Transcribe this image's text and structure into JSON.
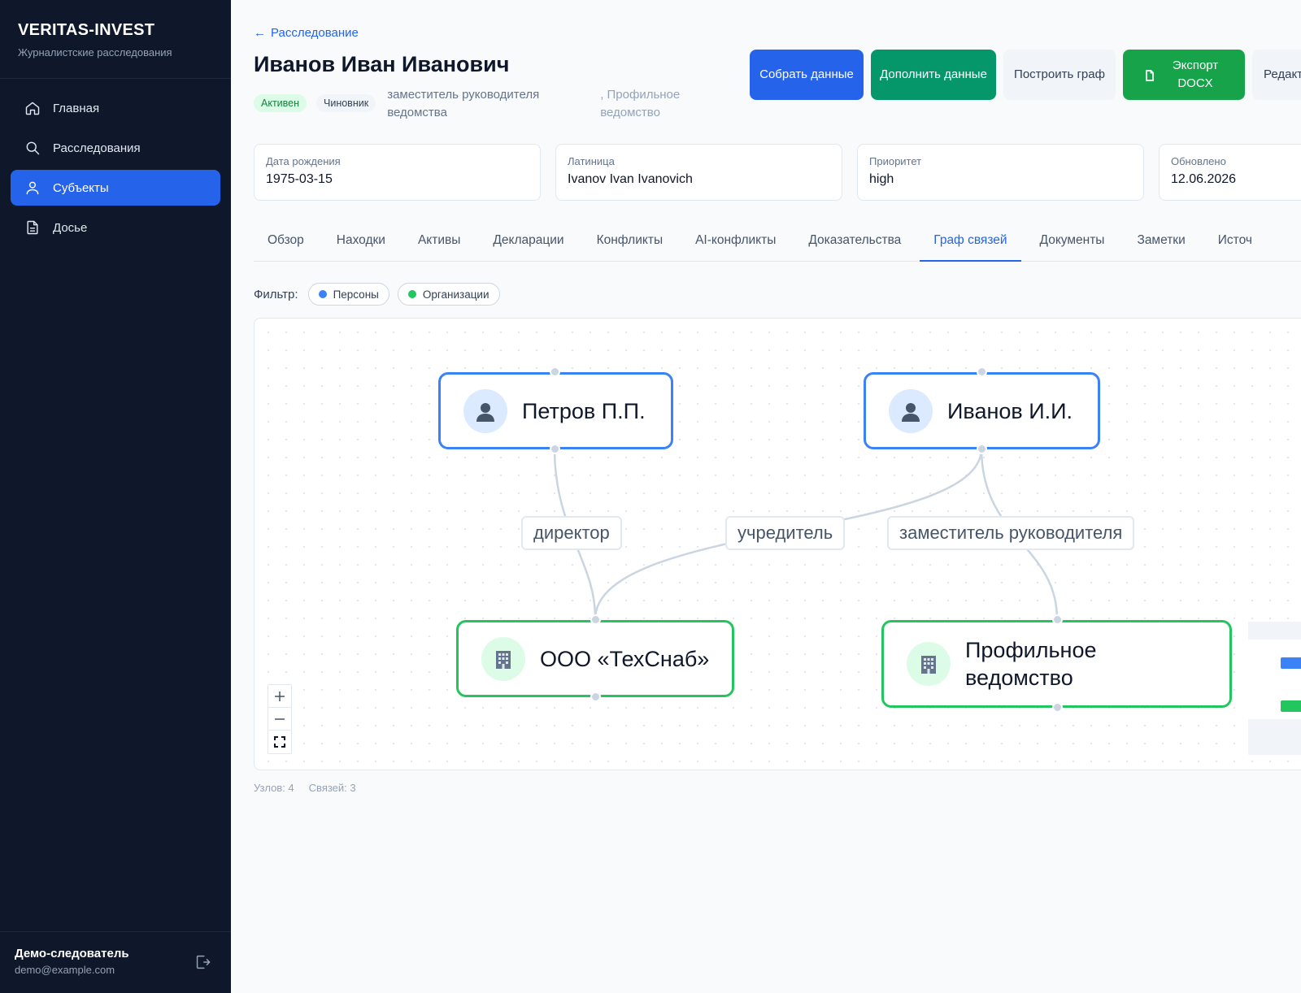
{
  "brand": {
    "title": "VERITAS-INVEST",
    "subtitle": "Журналистские расследования"
  },
  "nav": [
    {
      "label": "Главная",
      "icon": "home-icon"
    },
    {
      "label": "Расследования",
      "icon": "search-icon"
    },
    {
      "label": "Субъекты",
      "icon": "user-icon",
      "active": true
    },
    {
      "label": "Досье",
      "icon": "document-icon"
    }
  ],
  "user": {
    "name": "Демо-следователь",
    "email": "demo@example.com"
  },
  "header": {
    "back_label": "Расследование",
    "title": "Иванов Иван Иванович",
    "status_badge": "Активен",
    "role_badge": "Чиновник",
    "position": "заместитель руководителя ведомства",
    "organization": ", Профильное ведомство"
  },
  "actions": {
    "collect": "Собрать данные",
    "supplement": "Дополнить данные",
    "build_graph": "Построить граф",
    "export": "Экспорт DOCX",
    "edit": "Редакт"
  },
  "info": [
    {
      "label": "Дата рождения",
      "value": "1975-03-15"
    },
    {
      "label": "Латиница",
      "value": "Ivanov Ivan Ivanovich"
    },
    {
      "label": "Приоритет",
      "value": "high"
    },
    {
      "label": "Обновлено",
      "value": "12.06.2026"
    }
  ],
  "tabs": [
    "Обзор",
    "Находки",
    "Активы",
    "Декларации",
    "Конфликты",
    "AI-конфликты",
    "Доказательства",
    "Граф связей",
    "Документы",
    "Заметки",
    "Источ"
  ],
  "active_tab": "Граф связей",
  "filter": {
    "label": "Фильтр:",
    "chips": [
      {
        "label": "Персоны",
        "color": "#3b82f6"
      },
      {
        "label": "Организации",
        "color": "#22c55e"
      }
    ]
  },
  "graph": {
    "nodes": {
      "petrov": {
        "label": "Петров П.П.",
        "type": "person",
        "icon": "person-icon"
      },
      "ivanov": {
        "label": "Иванов И.И.",
        "type": "person",
        "icon": "person-icon"
      },
      "techsnab": {
        "label": "ООО «ТехСнаб»",
        "type": "org",
        "icon": "building-icon"
      },
      "vedomstvo": {
        "label": "Профильное ведомство",
        "type": "org",
        "icon": "building-icon"
      }
    },
    "edges": [
      {
        "from": "petrov",
        "to": "techsnab",
        "label": "директор"
      },
      {
        "from": "ivanov",
        "to": "techsnab",
        "label": "учредитель"
      },
      {
        "from": "ivanov",
        "to": "vedomstvo",
        "label": "заместитель руководителя"
      }
    ],
    "colors": {
      "person": "#3b82f6",
      "org": "#22c55e",
      "edge": "#cbd5e1"
    }
  },
  "stats": {
    "nodes": "Узлов: 4",
    "edges": "Связей: 3"
  }
}
